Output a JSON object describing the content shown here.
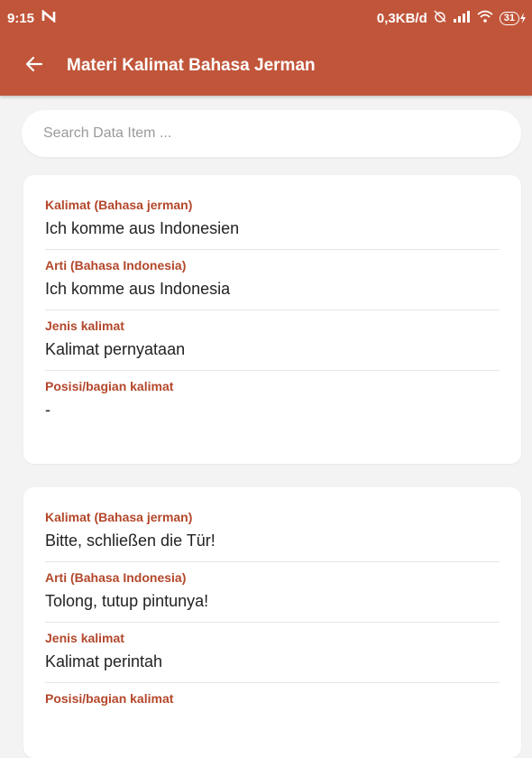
{
  "status": {
    "time": "9:15",
    "notification_icon": "n-icon",
    "speed": "0,3KB/d",
    "battery": "31"
  },
  "appbar": {
    "title": "Materi Kalimat Bahasa Jerman",
    "back_icon": "arrow-left-icon"
  },
  "search": {
    "placeholder": "Search Data Item ..."
  },
  "colors": {
    "primary": "#c1553a",
    "label": "#b3472b",
    "background": "#f3f3f3"
  },
  "cards": [
    {
      "fields": [
        {
          "label": "Kalimat (Bahasa jerman)",
          "value": "Ich komme aus Indonesien"
        },
        {
          "label": "Arti (Bahasa Indonesia)",
          "value": "Ich komme aus Indonesia"
        },
        {
          "label": "Jenis kalimat",
          "value": "Kalimat pernyataan"
        },
        {
          "label": "Posisi/bagian kalimat",
          "value": "-"
        }
      ]
    },
    {
      "fields": [
        {
          "label": "Kalimat (Bahasa jerman)",
          "value": "Bitte, schließen die Tür!"
        },
        {
          "label": "Arti (Bahasa Indonesia)",
          "value": "Tolong, tutup pintunya!"
        },
        {
          "label": "Jenis kalimat",
          "value": "Kalimat perintah"
        },
        {
          "label": "Posisi/bagian kalimat",
          "value": ""
        }
      ]
    }
  ]
}
